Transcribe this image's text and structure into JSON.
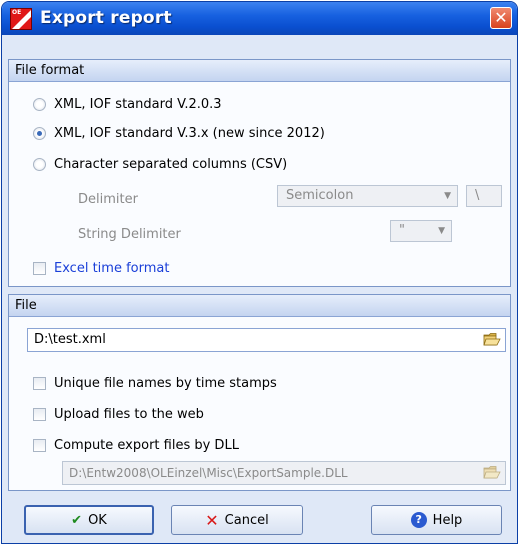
{
  "window": {
    "title": "Export report",
    "close_glyph": "✕",
    "icon": "app-flag-icon"
  },
  "file_format": {
    "header": "File format",
    "options": [
      {
        "label": "XML, IOF standard V.2.0.3",
        "selected": false
      },
      {
        "label": "XML, IOF standard V.3.x (new since 2012)",
        "selected": true
      },
      {
        "label": "Character separated columns (CSV)",
        "selected": false
      }
    ],
    "delimiter": {
      "label": "Delimiter",
      "value": "Semicolon",
      "custom": "\\"
    },
    "string_delimiter": {
      "label": "String Delimiter",
      "value": "\""
    },
    "excel_time": {
      "label": "Excel time format",
      "checked": false
    }
  },
  "file": {
    "header": "File",
    "path": "D:\\test.xml",
    "options": [
      {
        "label": "Unique file names by time stamps",
        "checked": false
      },
      {
        "label": "Upload files to the web",
        "checked": false
      },
      {
        "label": "Compute export files by DLL",
        "checked": false
      }
    ],
    "dll_path": "D:\\Entw2008\\OLEinzel\\Misc\\ExportSample.DLL"
  },
  "buttons": {
    "ok": {
      "label": "OK",
      "icon": "checkmark-icon"
    },
    "cancel": {
      "label": "Cancel",
      "icon": "x-icon"
    },
    "help": {
      "label": "Help",
      "icon": "help-icon"
    }
  }
}
